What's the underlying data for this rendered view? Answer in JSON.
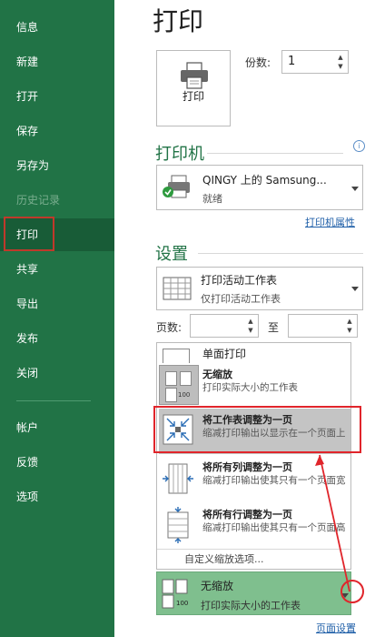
{
  "sidebar": {
    "items": [
      {
        "label": "信息"
      },
      {
        "label": "新建"
      },
      {
        "label": "打开"
      },
      {
        "label": "保存"
      },
      {
        "label": "另存为"
      },
      {
        "label": "历史记录"
      },
      {
        "label": "打印"
      },
      {
        "label": "共享"
      },
      {
        "label": "导出"
      },
      {
        "label": "发布"
      },
      {
        "label": "关闭"
      },
      {
        "label": "帐户"
      },
      {
        "label": "反馈"
      },
      {
        "label": "选项"
      }
    ]
  },
  "page": {
    "title": "打印"
  },
  "print": {
    "button_label": "打印",
    "copies_label": "份数:",
    "copies_value": "1"
  },
  "printer": {
    "section_title": "打印机",
    "name": "QINGY 上的 Samsung...",
    "status": "就绪",
    "properties_link": "打印机属性"
  },
  "settings": {
    "section_title": "设置",
    "scope": {
      "title": "打印活动工作表",
      "desc": "仅打印活动工作表"
    },
    "pages_label": "页数:",
    "to_label": "至",
    "pages_from": "",
    "pages_to": ""
  },
  "menu": {
    "partial_item": "单面打印",
    "items": [
      {
        "title": "无缩放",
        "desc": "打印实际大小的工作表"
      },
      {
        "title": "将工作表调整为一页",
        "desc": "缩减打印输出以显示在一个页面上"
      },
      {
        "title": "将所有列调整为一页",
        "desc": "缩减打印输出使其只有一个页面宽"
      },
      {
        "title": "将所有行调整为一页",
        "desc": "缩减打印输出使其只有一个页面高"
      }
    ],
    "custom_option": "自定义缩放选项..."
  },
  "scaling_selected": {
    "title": "无缩放",
    "desc": "打印实际大小的工作表"
  },
  "page_setup_link": "页面设置",
  "thumb_number": "100",
  "colors": {
    "sidebar": "#217346",
    "accent_red": "#e0252b",
    "link": "#1f5fa8"
  }
}
